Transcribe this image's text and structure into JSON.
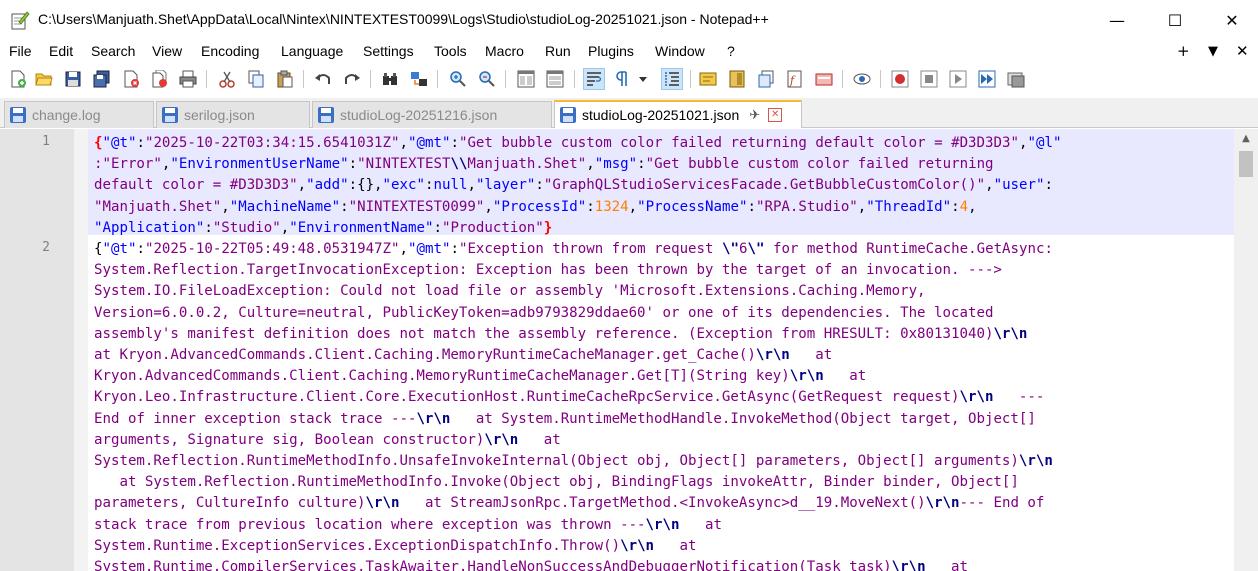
{
  "window": {
    "title": "C:\\Users\\Manjuath.Shet\\AppData\\Local\\Nintex\\NINTEXTEST0099\\Logs\\Studio\\studioLog-20251021.json - Notepad++",
    "minimize_glyph": "—",
    "maximize_glyph": "☐",
    "close_glyph": "✕"
  },
  "menu": {
    "items": [
      "File",
      "Edit",
      "Search",
      "View",
      "Encoding",
      "Language",
      "Settings",
      "Tools",
      "Macro",
      "Run",
      "Plugins",
      "Window",
      "?"
    ],
    "right_plus": "+",
    "right_down": "▼",
    "right_close": "✕"
  },
  "toolbar": {
    "icons": [
      "new-file-icon",
      "open-file-icon",
      "save-icon",
      "save-all-icon",
      "close-icon",
      "close-all-icon",
      "print-icon",
      "cut-icon",
      "copy-icon",
      "paste-icon",
      "undo-icon",
      "redo-icon",
      "find-icon",
      "replace-icon",
      "zoom-in-icon",
      "zoom-out-icon",
      "sync-vertical-icon",
      "sync-horizontal-icon",
      "word-wrap-icon",
      "show-all-chars-icon",
      "dropdown-icon",
      "indent-guide-icon",
      "user-language-icon",
      "document-map-icon",
      "document-list-icon",
      "function-list-icon",
      "folder-workspace-icon",
      "monitoring-icon",
      "record-macro-icon",
      "stop-macro-icon",
      "play-macro-icon",
      "run-macro-multiple-icon",
      "save-macro-icon"
    ]
  },
  "tabs": [
    {
      "label": "change.log",
      "active": false
    },
    {
      "label": "serilog.json",
      "active": false
    },
    {
      "label": "studioLog-20251216.json",
      "active": false
    },
    {
      "label": "studioLog-20251021.json",
      "active": true,
      "pin": "✈",
      "close": "✕"
    }
  ],
  "editor": {
    "line_numbers": [
      "1",
      "2"
    ],
    "scroll_up": "▲"
  },
  "colors": {
    "key": "#0000ff",
    "string": "#800080",
    "number": "#ff8000",
    "current_line": "#e8e8ff",
    "active_tab_accent": "#f7b834"
  }
}
